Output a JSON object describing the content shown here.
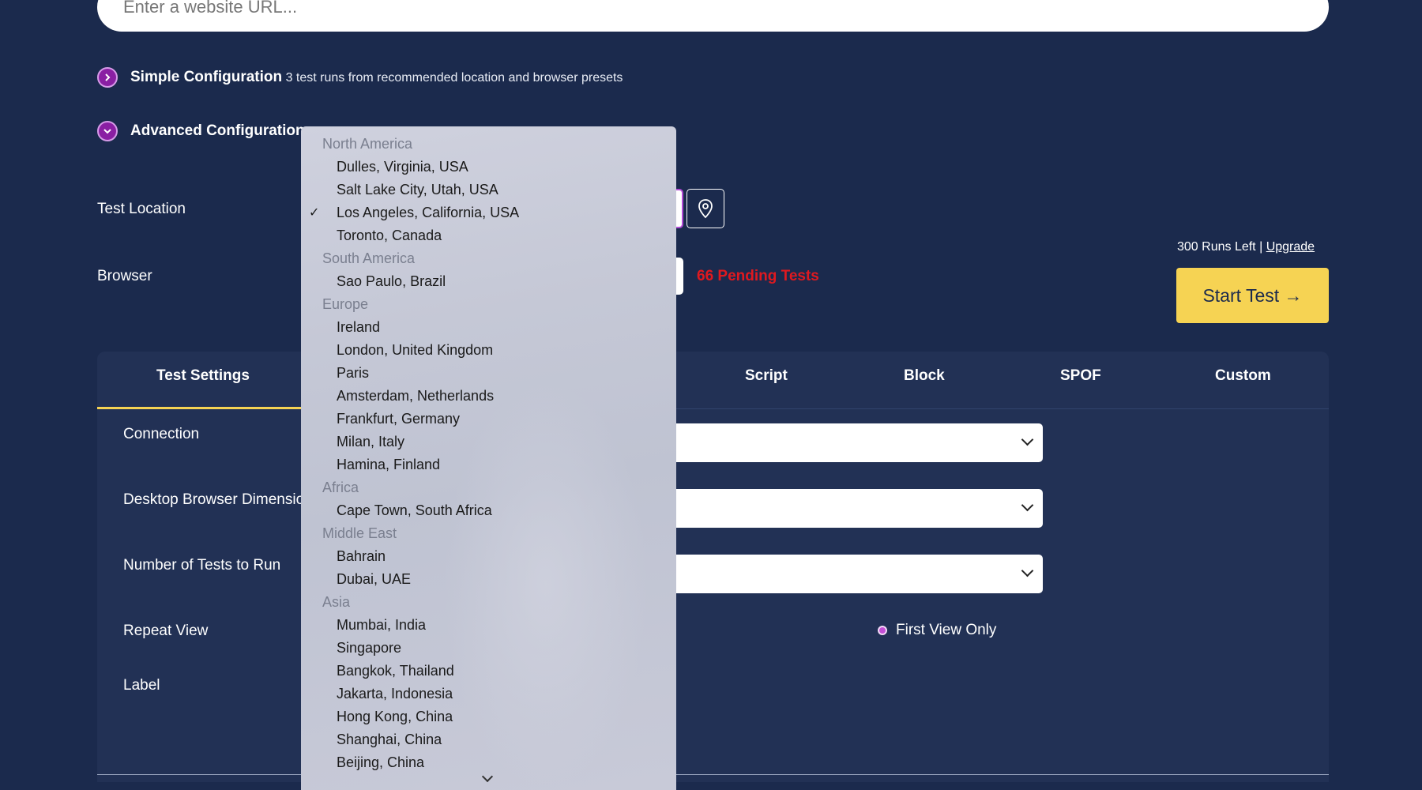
{
  "url_input": {
    "placeholder": "Enter a website URL..."
  },
  "simple_config": {
    "title": "Simple Configuration",
    "description": "3 test runs from recommended location and browser presets"
  },
  "advanced_config": {
    "title": "Advanced Configuration"
  },
  "fields": {
    "test_location_label": "Test Location",
    "browser_label": "Browser"
  },
  "pending_tests": "66 Pending Tests",
  "runs_left": {
    "text": "300 Runs Left |",
    "upgrade": "Upgrade"
  },
  "start_button": "Start Test →",
  "tabs": [
    {
      "label": "Test Settings"
    },
    {
      "label": "Script"
    },
    {
      "label": "Block"
    },
    {
      "label": "SPOF"
    },
    {
      "label": "Custom"
    }
  ],
  "settings": {
    "connection": "Connection",
    "dimensions": "Desktop Browser Dimensio",
    "num_tests": "Number of Tests to Run",
    "repeat_view": "Repeat View",
    "label": "Label",
    "first_view_only": "First View Only"
  },
  "location_dropdown": {
    "selected": "Los Angeles, California, USA",
    "groups": [
      {
        "name": "North America",
        "items": [
          "Dulles, Virginia, USA",
          "Salt Lake City, Utah, USA",
          "Los Angeles, California, USA",
          "Toronto, Canada"
        ]
      },
      {
        "name": "South America",
        "items": [
          "Sao Paulo, Brazil"
        ]
      },
      {
        "name": "Europe",
        "items": [
          "Ireland",
          "London, United Kingdom",
          "Paris",
          "Amsterdam, Netherlands",
          "Frankfurt, Germany",
          "Milan, Italy",
          "Hamina, Finland"
        ]
      },
      {
        "name": "Africa",
        "items": [
          "Cape Town, South Africa"
        ]
      },
      {
        "name": "Middle East",
        "items": [
          "Bahrain",
          "Dubai, UAE"
        ]
      },
      {
        "name": "Asia",
        "items": [
          "Mumbai, India",
          "Singapore",
          "Bangkok, Thailand",
          "Jakarta, Indonesia",
          "Hong Kong, China",
          "Shanghai, China",
          "Beijing, China"
        ]
      }
    ]
  },
  "colors": {
    "background": "#1b2a4d",
    "panel": "#223155",
    "accent_purple": "#8a1fa3",
    "start_button": "#f6d353",
    "pending_red": "#e0191f"
  }
}
